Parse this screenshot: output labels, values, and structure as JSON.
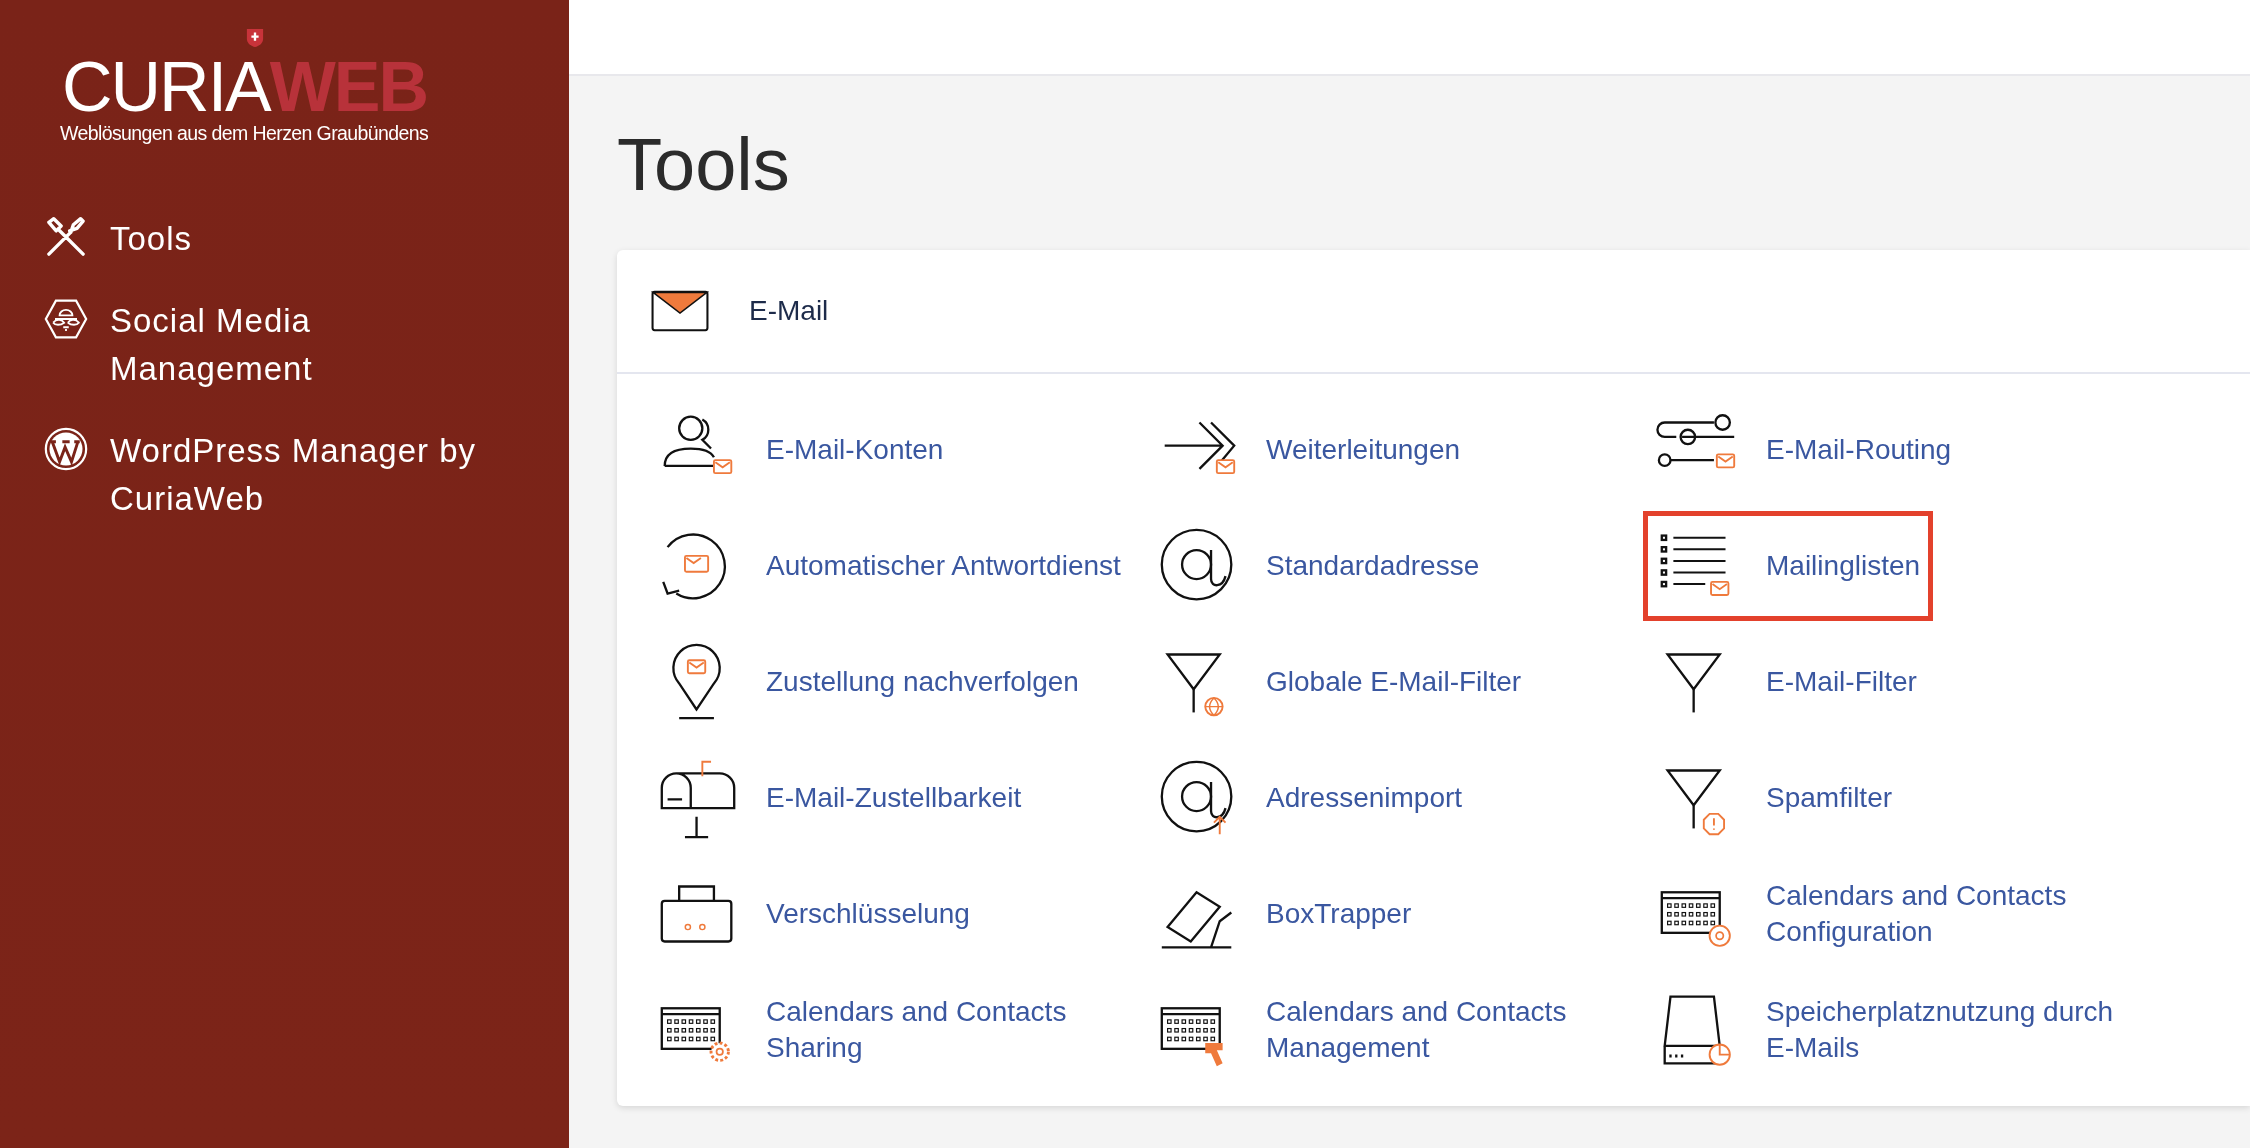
{
  "logo": {
    "part_1": "CURIA",
    "part_2": "WEB",
    "tagline": "Weblösungen aus dem Herzen Graubündens"
  },
  "sidebar": {
    "items": [
      {
        "label": "Tools"
      },
      {
        "label": "Social Media Management"
      },
      {
        "label": "WordPress Manager by CuriaWeb"
      }
    ]
  },
  "page_title": "Tools",
  "section": {
    "title": "E-Mail",
    "items": [
      {
        "label": "E-Mail-Konten",
        "highlighted": false
      },
      {
        "label": "Automatischer Antwortdienst",
        "highlighted": false
      },
      {
        "label": "Zustellung nachverfolgen",
        "highlighted": false
      },
      {
        "label": "E-Mail-Zustellbarkeit",
        "highlighted": false
      },
      {
        "label": "Verschlüsselung",
        "highlighted": false
      },
      {
        "label": "Calendars and Contacts Sharing",
        "highlighted": false
      },
      {
        "label": "Weiterleitungen",
        "highlighted": false
      },
      {
        "label": "Standardadresse",
        "highlighted": false
      },
      {
        "label": "Globale E-Mail-Filter",
        "highlighted": false
      },
      {
        "label": "Adressenimport",
        "highlighted": false
      },
      {
        "label": "BoxTrapper",
        "highlighted": false
      },
      {
        "label": "Calendars and Contacts Management",
        "highlighted": false
      },
      {
        "label": "E-Mail-Routing",
        "highlighted": false
      },
      {
        "label": "Mailinglisten",
        "highlighted": true
      },
      {
        "label": "E-Mail-Filter",
        "highlighted": false
      },
      {
        "label": "Spamfilter",
        "highlighted": false
      },
      {
        "label": "Calendars and Contacts Configuration",
        "highlighted": false
      },
      {
        "label": "Speicherplatznutzung durch E-Mails",
        "highlighted": false
      }
    ]
  }
}
